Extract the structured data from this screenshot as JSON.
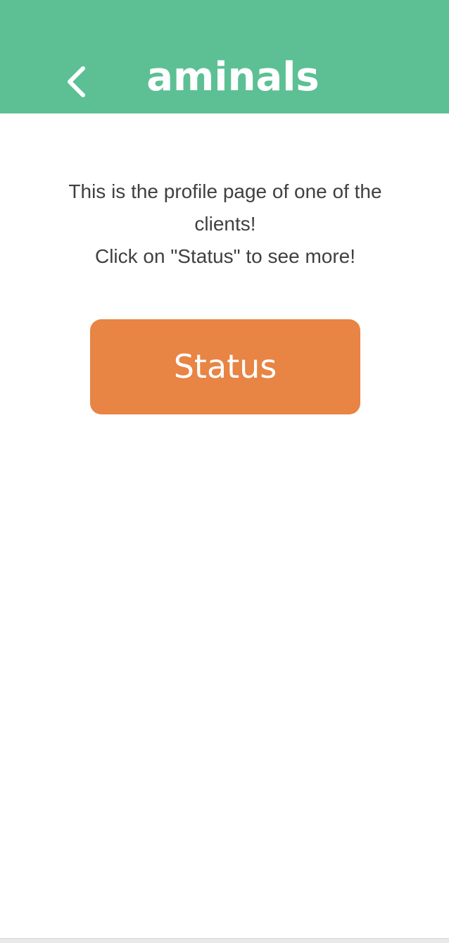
{
  "header": {
    "title": "aminals",
    "back_icon": "chevron-left-icon",
    "background_color": "#5cc094"
  },
  "main": {
    "intro_line1": "This is the profile page of one of the clients!",
    "intro_line2": "Click on \"Status\" to see more!",
    "status_button_label": "Status",
    "button_color": "#e88444",
    "text_color": "#404040"
  }
}
